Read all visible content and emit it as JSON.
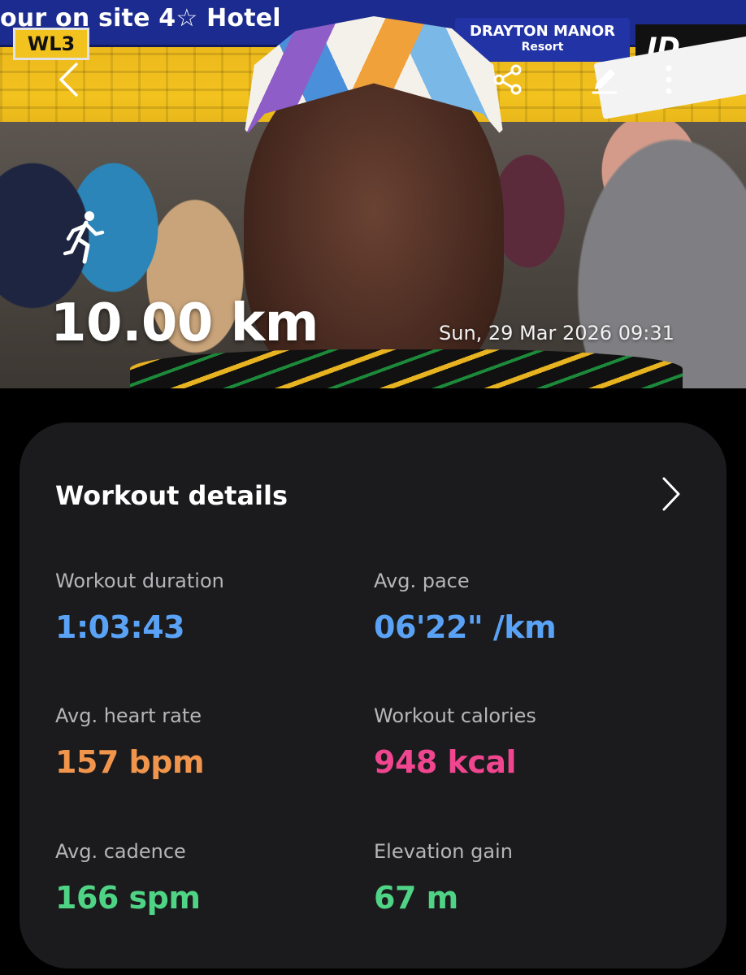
{
  "hero": {
    "banner_text": "our on site 4☆ Hotel",
    "banner_resort_name": "DRAYTON MANOR",
    "banner_resort_sub": "Resort",
    "banner_jd": "JD",
    "section_sign": "WL3",
    "distance": "10.00 km",
    "datetime": "Sun, 29 Mar 2026 09:31",
    "activity_icon": "running-icon"
  },
  "toolbar": {
    "back_icon": "back-chevron-icon",
    "share_icon": "share-icon",
    "edit_icon": "edit-pencil-icon",
    "more_icon": "more-vertical-icon"
  },
  "card": {
    "title": "Workout details",
    "chevron_icon": "chevron-right-icon",
    "metrics": [
      {
        "label": "Workout duration",
        "value": "1:03:43",
        "color": "#5aa2f5"
      },
      {
        "label": "Avg. pace",
        "value": "06'22\" /km",
        "color": "#5aa2f5"
      },
      {
        "label": "Avg. heart rate",
        "value": "157 bpm",
        "color": "#f0954b"
      },
      {
        "label": "Workout calories",
        "value": "948 kcal",
        "color": "#f0468f"
      },
      {
        "label": "Avg. cadence",
        "value": "166 spm",
        "color": "#4fd486"
      },
      {
        "label": "Elevation gain",
        "value": "67 m",
        "color": "#4fd486"
      }
    ]
  },
  "colors": {
    "background": "#000000",
    "card_background": "#1b1b1d",
    "label_text": "#b6b6b9",
    "title_text": "#ffffff"
  }
}
